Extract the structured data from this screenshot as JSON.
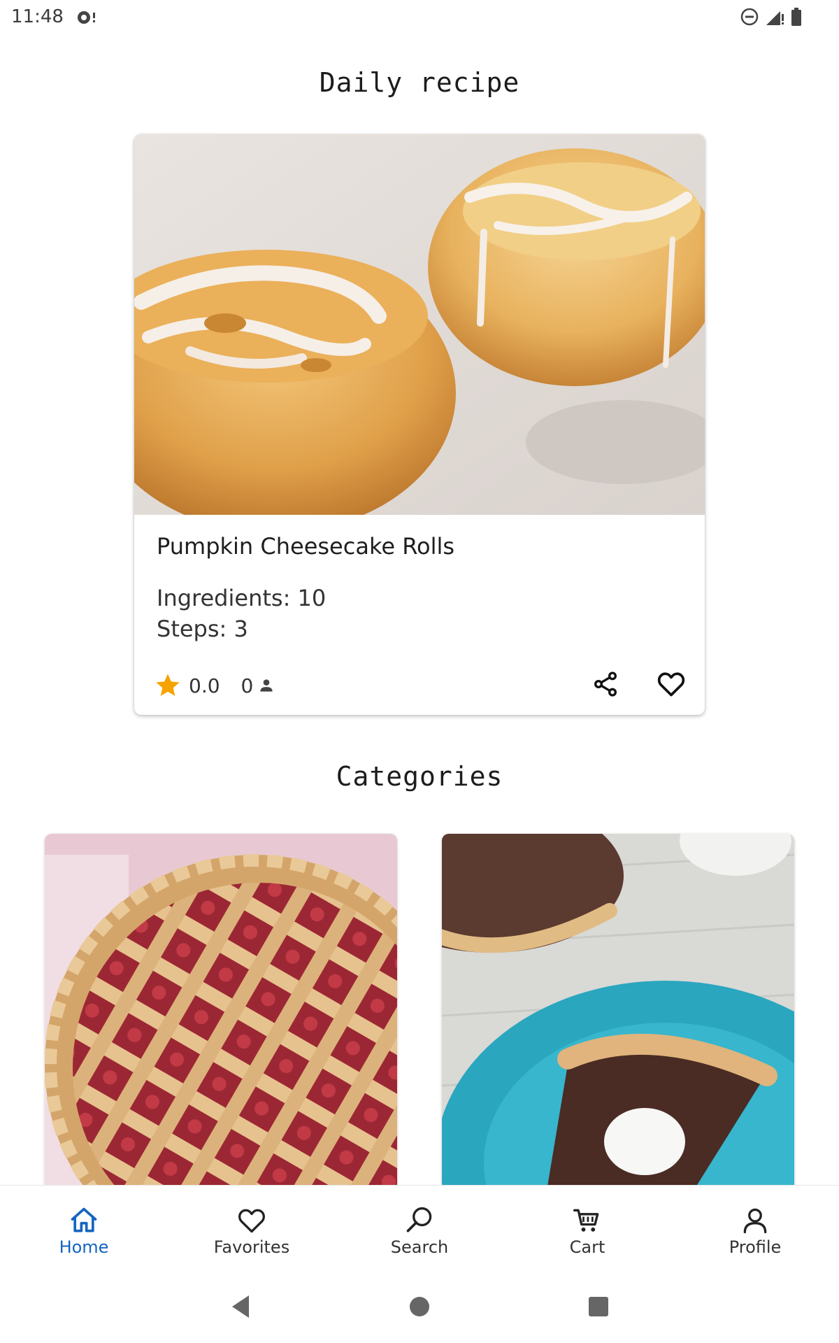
{
  "status_bar": {
    "time": "11:48",
    "icons": [
      "notification-icon",
      "do-not-disturb-icon",
      "signal-icon",
      "battery-icon"
    ]
  },
  "daily": {
    "heading": "Daily recipe",
    "recipe": {
      "name": "Pumpkin Cheesecake Rolls",
      "ingredients": "Ingredients: 10",
      "steps": "Steps: 3",
      "rating": "0.0",
      "review_count": "0"
    }
  },
  "categories": {
    "heading": "Categories"
  },
  "bottom_nav": {
    "items": [
      {
        "label": "Home",
        "icon": "home-icon",
        "active": true
      },
      {
        "label": "Favorites",
        "icon": "heart-icon",
        "active": false
      },
      {
        "label": "Search",
        "icon": "search-icon",
        "active": false
      },
      {
        "label": "Cart",
        "icon": "cart-icon",
        "active": false
      },
      {
        "label": "Profile",
        "icon": "person-icon",
        "active": false
      }
    ]
  },
  "colors": {
    "accent": "#1565c0",
    "star": "#f5a300",
    "text": "#1c1c1c"
  }
}
